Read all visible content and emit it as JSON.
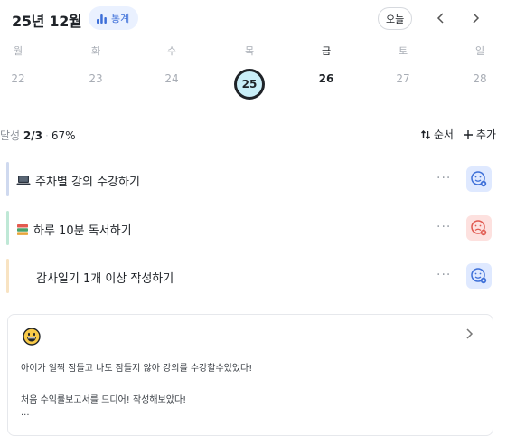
{
  "header": {
    "month_label": "25년 12월",
    "stats_label": "통계",
    "today_label": "오늘",
    "prev_label": "‹",
    "next_label": "›"
  },
  "week": {
    "days": [
      {
        "dow": "월",
        "date": "22",
        "selected": false,
        "strong": false
      },
      {
        "dow": "화",
        "date": "23",
        "selected": false,
        "strong": false
      },
      {
        "dow": "수",
        "date": "24",
        "selected": false,
        "strong": false
      },
      {
        "dow": "목",
        "date": "25",
        "selected": true,
        "strong": false
      },
      {
        "dow": "금",
        "date": "26",
        "selected": false,
        "strong": true
      },
      {
        "dow": "토",
        "date": "27",
        "selected": false,
        "strong": false
      },
      {
        "dow": "일",
        "date": "28",
        "selected": false,
        "strong": false
      }
    ]
  },
  "summary": {
    "prefix": "달성",
    "count": "2/3",
    "percent": "67%",
    "order_label": "순서",
    "add_label": "추가"
  },
  "tasks": [
    {
      "title": "주차별 강의 수강하기",
      "icon": "laptop-icon",
      "bar_color": "#cfd9ef",
      "status": "ok"
    },
    {
      "title": "하루 10분 독서하기",
      "icon": "books-icon",
      "bar_color": "#bfe8d6",
      "status": "bad"
    },
    {
      "title": "감사일기 1개 이상 작성하기",
      "icon": "",
      "bar_color": "#f8e3c2",
      "status": "ok"
    }
  ],
  "colors": {
    "accent": "#3d6fd8",
    "status_ok_bg": "#dfe9ff",
    "status_bad_bg": "#fde1df",
    "selected_circle": "#c9eef8"
  },
  "diary": {
    "mood_icon": "grinning-face-icon",
    "line1": "아이가 일찍 잠들고 나도 잠들지 않아 강의를 수강할수있었다!",
    "line2": "처음 수익률보고서를 드디어! 작성해보았다!",
    "line3": "..."
  }
}
